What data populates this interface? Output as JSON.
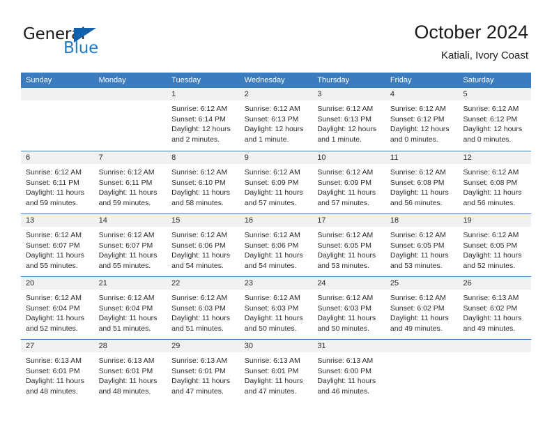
{
  "brand": {
    "name_top": "General",
    "name_bottom": "Blue",
    "color_dark": "#1b1b1b",
    "color_blue": "#1d7cc4",
    "triangle_color": "#1162ad"
  },
  "header": {
    "title": "October 2024",
    "subtitle": "Katiali, Ivory Coast"
  },
  "theme": {
    "header_bar": "#3a7cbe",
    "day_band": "#f1f1f1",
    "text": "#2b2b2b",
    "page_bg": "#ffffff"
  },
  "weekdays": [
    "Sunday",
    "Monday",
    "Tuesday",
    "Wednesday",
    "Thursday",
    "Friday",
    "Saturday"
  ],
  "weeks": [
    [
      {
        "day": "",
        "lines": []
      },
      {
        "day": "",
        "lines": []
      },
      {
        "day": "1",
        "lines": [
          "Sunrise: 6:12 AM",
          "Sunset: 6:14 PM",
          "Daylight: 12 hours",
          "and 2 minutes."
        ]
      },
      {
        "day": "2",
        "lines": [
          "Sunrise: 6:12 AM",
          "Sunset: 6:13 PM",
          "Daylight: 12 hours",
          "and 1 minute."
        ]
      },
      {
        "day": "3",
        "lines": [
          "Sunrise: 6:12 AM",
          "Sunset: 6:13 PM",
          "Daylight: 12 hours",
          "and 1 minute."
        ]
      },
      {
        "day": "4",
        "lines": [
          "Sunrise: 6:12 AM",
          "Sunset: 6:12 PM",
          "Daylight: 12 hours",
          "and 0 minutes."
        ]
      },
      {
        "day": "5",
        "lines": [
          "Sunrise: 6:12 AM",
          "Sunset: 6:12 PM",
          "Daylight: 12 hours",
          "and 0 minutes."
        ]
      }
    ],
    [
      {
        "day": "6",
        "lines": [
          "Sunrise: 6:12 AM",
          "Sunset: 6:11 PM",
          "Daylight: 11 hours",
          "and 59 minutes."
        ]
      },
      {
        "day": "7",
        "lines": [
          "Sunrise: 6:12 AM",
          "Sunset: 6:11 PM",
          "Daylight: 11 hours",
          "and 59 minutes."
        ]
      },
      {
        "day": "8",
        "lines": [
          "Sunrise: 6:12 AM",
          "Sunset: 6:10 PM",
          "Daylight: 11 hours",
          "and 58 minutes."
        ]
      },
      {
        "day": "9",
        "lines": [
          "Sunrise: 6:12 AM",
          "Sunset: 6:09 PM",
          "Daylight: 11 hours",
          "and 57 minutes."
        ]
      },
      {
        "day": "10",
        "lines": [
          "Sunrise: 6:12 AM",
          "Sunset: 6:09 PM",
          "Daylight: 11 hours",
          "and 57 minutes."
        ]
      },
      {
        "day": "11",
        "lines": [
          "Sunrise: 6:12 AM",
          "Sunset: 6:08 PM",
          "Daylight: 11 hours",
          "and 56 minutes."
        ]
      },
      {
        "day": "12",
        "lines": [
          "Sunrise: 6:12 AM",
          "Sunset: 6:08 PM",
          "Daylight: 11 hours",
          "and 56 minutes."
        ]
      }
    ],
    [
      {
        "day": "13",
        "lines": [
          "Sunrise: 6:12 AM",
          "Sunset: 6:07 PM",
          "Daylight: 11 hours",
          "and 55 minutes."
        ]
      },
      {
        "day": "14",
        "lines": [
          "Sunrise: 6:12 AM",
          "Sunset: 6:07 PM",
          "Daylight: 11 hours",
          "and 55 minutes."
        ]
      },
      {
        "day": "15",
        "lines": [
          "Sunrise: 6:12 AM",
          "Sunset: 6:06 PM",
          "Daylight: 11 hours",
          "and 54 minutes."
        ]
      },
      {
        "day": "16",
        "lines": [
          "Sunrise: 6:12 AM",
          "Sunset: 6:06 PM",
          "Daylight: 11 hours",
          "and 54 minutes."
        ]
      },
      {
        "day": "17",
        "lines": [
          "Sunrise: 6:12 AM",
          "Sunset: 6:05 PM",
          "Daylight: 11 hours",
          "and 53 minutes."
        ]
      },
      {
        "day": "18",
        "lines": [
          "Sunrise: 6:12 AM",
          "Sunset: 6:05 PM",
          "Daylight: 11 hours",
          "and 53 minutes."
        ]
      },
      {
        "day": "19",
        "lines": [
          "Sunrise: 6:12 AM",
          "Sunset: 6:05 PM",
          "Daylight: 11 hours",
          "and 52 minutes."
        ]
      }
    ],
    [
      {
        "day": "20",
        "lines": [
          "Sunrise: 6:12 AM",
          "Sunset: 6:04 PM",
          "Daylight: 11 hours",
          "and 52 minutes."
        ]
      },
      {
        "day": "21",
        "lines": [
          "Sunrise: 6:12 AM",
          "Sunset: 6:04 PM",
          "Daylight: 11 hours",
          "and 51 minutes."
        ]
      },
      {
        "day": "22",
        "lines": [
          "Sunrise: 6:12 AM",
          "Sunset: 6:03 PM",
          "Daylight: 11 hours",
          "and 51 minutes."
        ]
      },
      {
        "day": "23",
        "lines": [
          "Sunrise: 6:12 AM",
          "Sunset: 6:03 PM",
          "Daylight: 11 hours",
          "and 50 minutes."
        ]
      },
      {
        "day": "24",
        "lines": [
          "Sunrise: 6:12 AM",
          "Sunset: 6:03 PM",
          "Daylight: 11 hours",
          "and 50 minutes."
        ]
      },
      {
        "day": "25",
        "lines": [
          "Sunrise: 6:12 AM",
          "Sunset: 6:02 PM",
          "Daylight: 11 hours",
          "and 49 minutes."
        ]
      },
      {
        "day": "26",
        "lines": [
          "Sunrise: 6:13 AM",
          "Sunset: 6:02 PM",
          "Daylight: 11 hours",
          "and 49 minutes."
        ]
      }
    ],
    [
      {
        "day": "27",
        "lines": [
          "Sunrise: 6:13 AM",
          "Sunset: 6:01 PM",
          "Daylight: 11 hours",
          "and 48 minutes."
        ]
      },
      {
        "day": "28",
        "lines": [
          "Sunrise: 6:13 AM",
          "Sunset: 6:01 PM",
          "Daylight: 11 hours",
          "and 48 minutes."
        ]
      },
      {
        "day": "29",
        "lines": [
          "Sunrise: 6:13 AM",
          "Sunset: 6:01 PM",
          "Daylight: 11 hours",
          "and 47 minutes."
        ]
      },
      {
        "day": "30",
        "lines": [
          "Sunrise: 6:13 AM",
          "Sunset: 6:01 PM",
          "Daylight: 11 hours",
          "and 47 minutes."
        ]
      },
      {
        "day": "31",
        "lines": [
          "Sunrise: 6:13 AM",
          "Sunset: 6:00 PM",
          "Daylight: 11 hours",
          "and 46 minutes."
        ]
      },
      {
        "day": "",
        "lines": []
      },
      {
        "day": "",
        "lines": []
      }
    ]
  ]
}
